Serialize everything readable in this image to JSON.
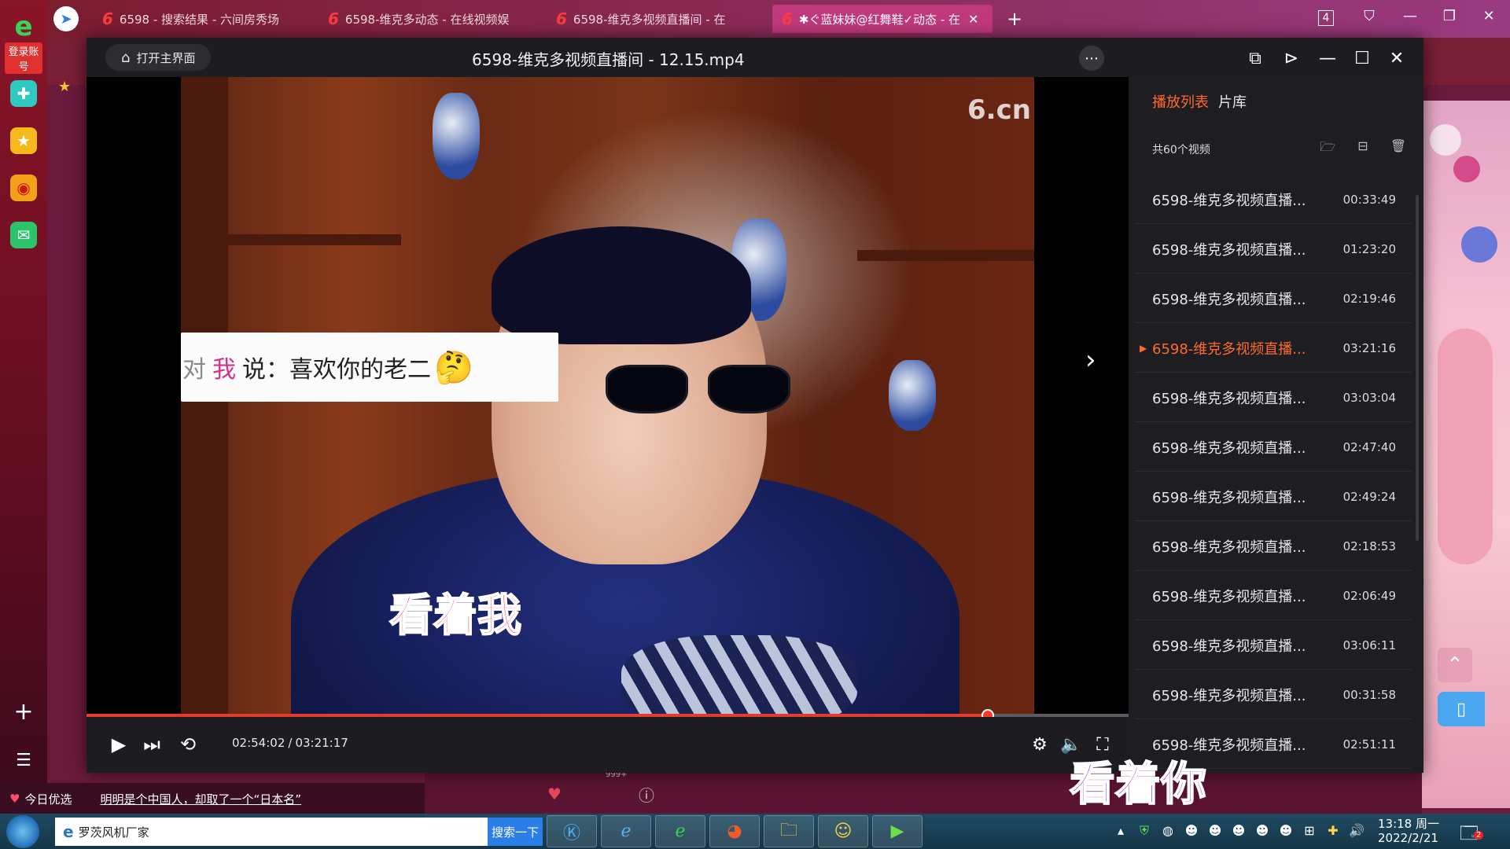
{
  "browser": {
    "logo_letter": "e",
    "login_label": "登录账号",
    "tabs": [
      {
        "label": "6598 - 搜索结果 - 六间房秀场"
      },
      {
        "label": "6598-维克多动态 - 在线视频娱"
      },
      {
        "label": "6598-维克多视频直播间 - 在"
      },
      {
        "label": "✱ぐ蓝妹妹@红舞鞋✓动态 - 在"
      }
    ],
    "tab_badge": "4"
  },
  "sidebar": {
    "icons": [
      "add-circle-icon",
      "star-icon",
      "weibo-icon",
      "mail-icon"
    ]
  },
  "player": {
    "open_main_label": "打开主界面",
    "title": "6598-维克多视频直播间 - 12.15.mp4",
    "watermark": "6.cn",
    "danmu": {
      "to": "对",
      "me": "我",
      "text": "说：喜欢你的老二",
      "emoji": "🤔"
    },
    "subtitle_left": "看着我",
    "subtitle_right": "看着你",
    "current_time": "02:54:02",
    "total_time": "03:21:17",
    "time_sep": "/",
    "progress": 0.865
  },
  "playlist": {
    "tab_playlist": "播放列表",
    "tab_library": "片库",
    "count_label": "共60个视频",
    "items": [
      {
        "name": "6598-维克多视频直播...",
        "duration": "00:33:49",
        "current": false
      },
      {
        "name": "6598-维克多视频直播...",
        "duration": "01:23:20",
        "current": false
      },
      {
        "name": "6598-维克多视频直播...",
        "duration": "02:19:46",
        "current": false
      },
      {
        "name": "6598-维克多视频直播...",
        "duration": "03:21:16",
        "current": true
      },
      {
        "name": "6598-维克多视频直播...",
        "duration": "03:03:04",
        "current": false
      },
      {
        "name": "6598-维克多视频直播...",
        "duration": "02:47:40",
        "current": false
      },
      {
        "name": "6598-维克多视频直播...",
        "duration": "02:49:24",
        "current": false
      },
      {
        "name": "6598-维克多视频直播...",
        "duration": "02:18:53",
        "current": false
      },
      {
        "name": "6598-维克多视频直播...",
        "duration": "02:06:49",
        "current": false
      },
      {
        "name": "6598-维克多视频直播...",
        "duration": "03:06:11",
        "current": false
      },
      {
        "name": "6598-维克多视频直播...",
        "duration": "00:31:58",
        "current": false
      },
      {
        "name": "6598-维克多视频直播...",
        "duration": "02:51:11",
        "current": false
      }
    ]
  },
  "underlay": {
    "today_label": "今日优选",
    "headline": "明明是个中国人，却取了一个“日本名”",
    "badge_999": "999+"
  },
  "taskbar": {
    "address_text": "罗茨风机厂家",
    "search_label": "搜索一下",
    "time": "13:18 周一",
    "date": "2022/2/21",
    "notif_count": "2"
  },
  "colors": {
    "accent": "#ff6a2e",
    "progress": "#e33b2e",
    "player_bg": "#1e1e22"
  }
}
